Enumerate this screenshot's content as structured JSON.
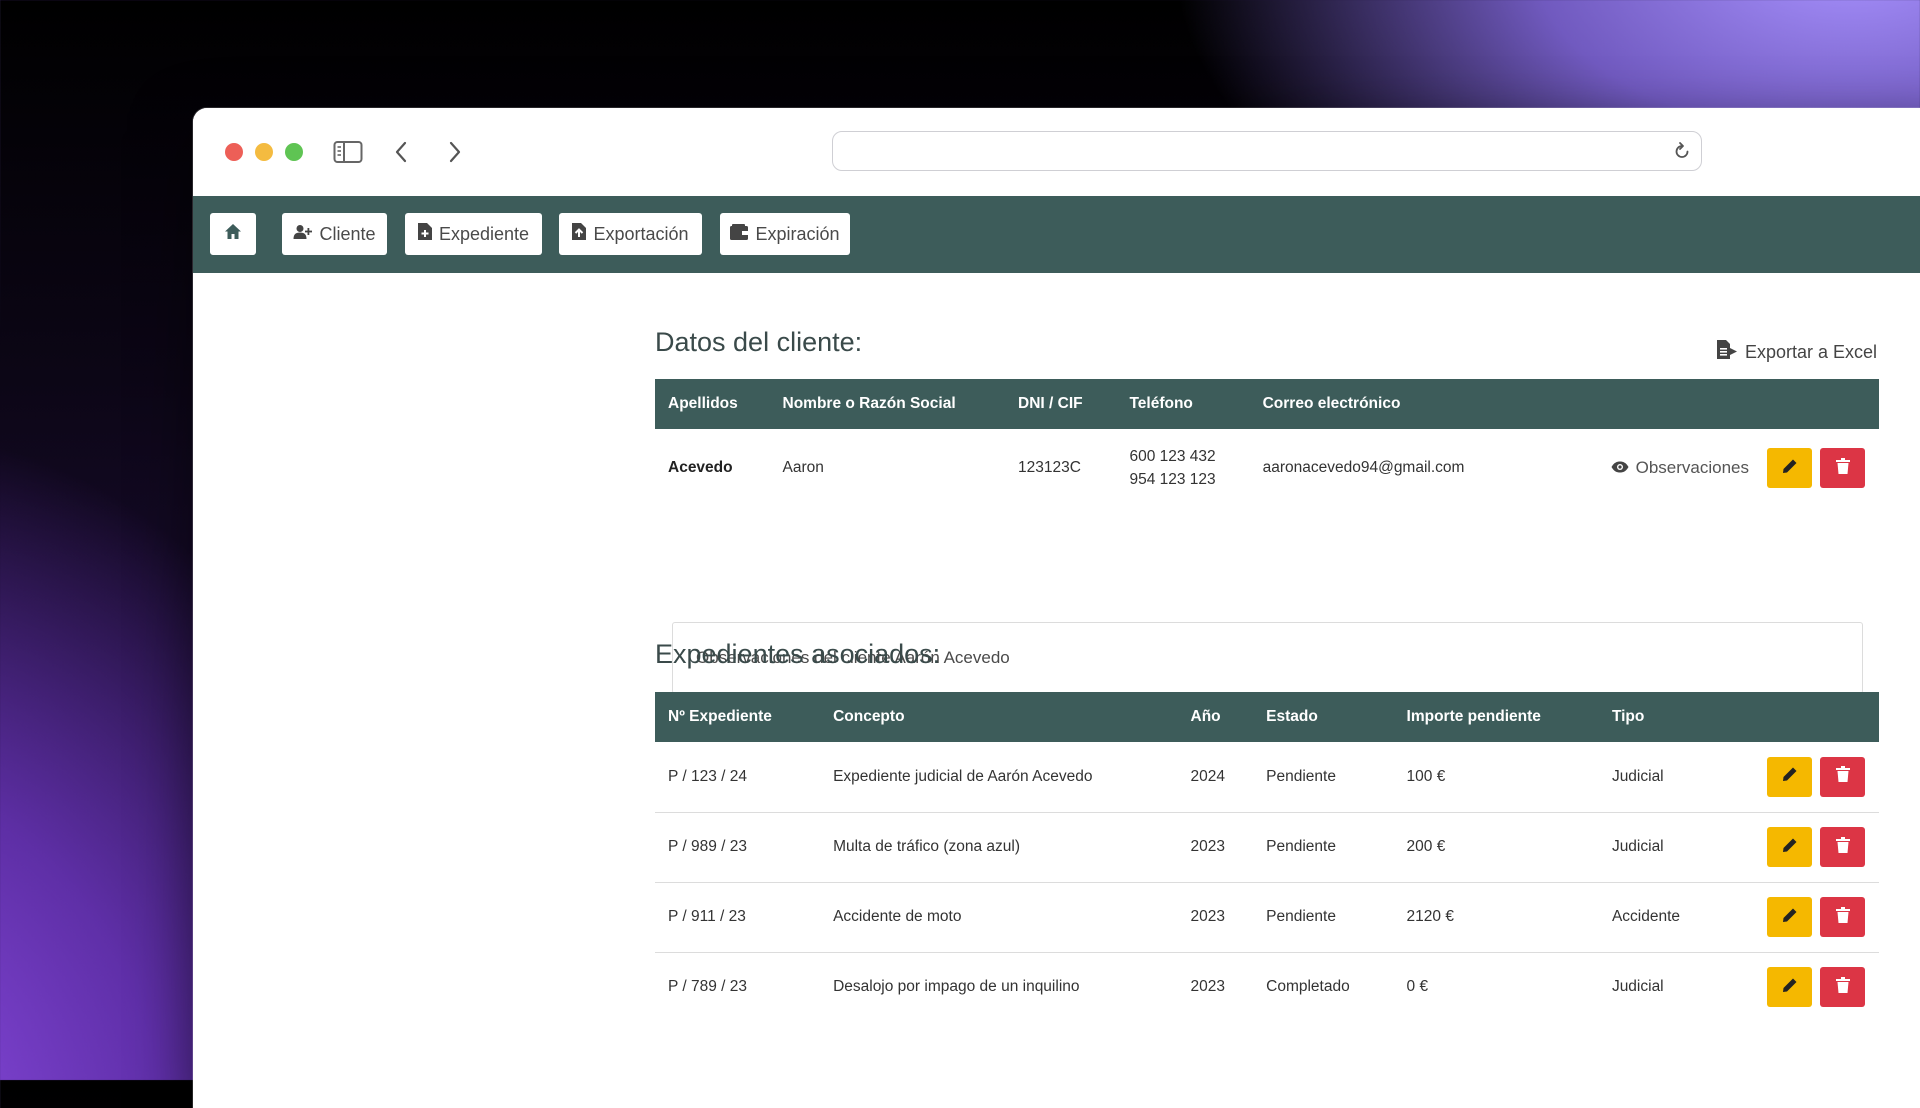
{
  "nav": {
    "home": "Inicio",
    "items": [
      {
        "label": "Cliente"
      },
      {
        "label": "Expediente"
      },
      {
        "label": "Exportación"
      },
      {
        "label": "Expiración"
      }
    ]
  },
  "client_section": {
    "title": "Datos del cliente:",
    "export_label": "Exportar a Excel",
    "headers": [
      "Apellidos",
      "Nombre o Razón Social",
      "DNI / CIF",
      "Teléfono",
      "Correo electrónico"
    ],
    "row": {
      "apellidos": "Acevedo",
      "nombre": "Aaron",
      "dni": "123123C",
      "telefono1": "600 123 432",
      "telefono2": "954 123 123",
      "correo": "aaronacevedo94@gmail.com",
      "observaciones_label": "Observaciones"
    },
    "observaciones_text": "Observaciones del cliente Aarón Acevedo"
  },
  "files_section": {
    "title": "Expedientes asociados:",
    "headers": [
      "Nº Expediente",
      "Concepto",
      "Año",
      "Estado",
      "Importe pendiente",
      "Tipo"
    ],
    "rows": [
      {
        "numero": "P / 123 / 24",
        "concepto": "Expediente judicial de Aarón Acevedo",
        "anio": "2024",
        "estado": "Pendiente",
        "importe": "100 €",
        "tipo": "Judicial"
      },
      {
        "numero": "P / 989 / 23",
        "concepto": "Multa de tráfico (zona azul)",
        "anio": "2023",
        "estado": "Pendiente",
        "importe": "200 €",
        "tipo": "Judicial"
      },
      {
        "numero": "P / 911 / 23",
        "concepto": "Accidente de moto",
        "anio": "2023",
        "estado": "Pendiente",
        "importe": "2120 €",
        "tipo": "Accidente"
      },
      {
        "numero": "P / 789 / 23",
        "concepto": "Desalojo por impago de un inquilino",
        "anio": "2023",
        "estado": "Completado",
        "importe": "0 €",
        "tipo": "Judicial"
      }
    ]
  },
  "colors": {
    "navbar": "#3d5c5a",
    "edit_button": "#f5b800",
    "delete_button": "#dc3545"
  },
  "icons": [
    "home-icon",
    "user-plus-icon",
    "file-plus-icon",
    "file-export-icon",
    "wallet-icon",
    "file-excel-icon",
    "eye-icon",
    "pencil-icon",
    "trash-icon",
    "sidebar-icon",
    "chevron-left-icon",
    "chevron-right-icon",
    "reload-icon"
  ]
}
